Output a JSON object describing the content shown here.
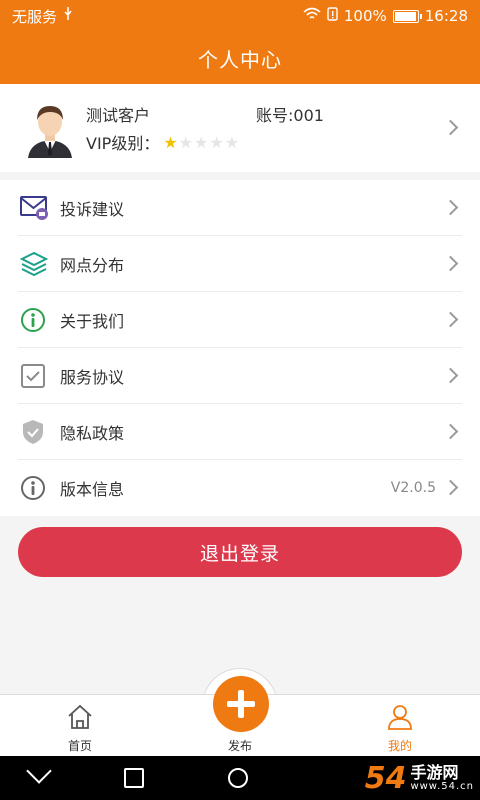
{
  "status_bar": {
    "carrier": "无服务",
    "battery": "100%",
    "battery_level": 1.0,
    "time": "16:28"
  },
  "header": {
    "title": "个人中心"
  },
  "profile": {
    "name": "测试客户",
    "account": "账号:001",
    "vip_label": "VIP级别：",
    "vip_stars_filled": 1,
    "vip_stars_total": 5
  },
  "menu": {
    "items": [
      {
        "label": "投诉建议",
        "icon": "mail-icon"
      },
      {
        "label": "网点分布",
        "icon": "layers-icon"
      },
      {
        "label": "关于我们",
        "icon": "info-circle-icon"
      },
      {
        "label": "服务协议",
        "icon": "checkbox-icon"
      },
      {
        "label": "隐私政策",
        "icon": "shield-icon"
      },
      {
        "label": "版本信息",
        "icon": "info-icon",
        "value": "V2.0.5"
      }
    ]
  },
  "logout": {
    "label": "退出登录"
  },
  "tabbar": {
    "tabs": [
      {
        "label": "首页",
        "icon": "home-icon"
      },
      {
        "label": "发布",
        "icon": "plus-icon"
      },
      {
        "label": "我的",
        "icon": "user-icon"
      }
    ],
    "active_color": "#f07a12"
  },
  "theme": {
    "primary": "#f07a12",
    "danger": "#dc3a4c"
  },
  "watermark": {
    "number": "54",
    "line1": "手游网",
    "line2": "www.54.cn"
  }
}
